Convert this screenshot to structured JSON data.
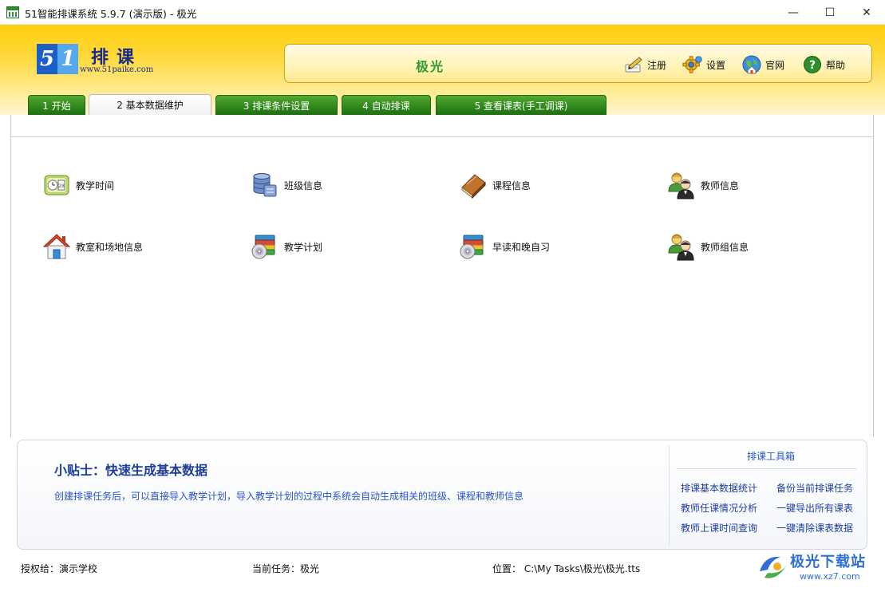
{
  "window": {
    "title": "51智能排课系统 5.9.7 (演示版) - 极光",
    "minimize": "—",
    "maximize": "☐",
    "close": "✕"
  },
  "logo": {
    "digit1": "5",
    "digit2": "1",
    "title": "排课",
    "url": "www.51paike.com"
  },
  "infobar": {
    "task_name": "极光",
    "buttons": [
      {
        "label": "注册",
        "icon": "register-icon"
      },
      {
        "label": "设置",
        "icon": "gear-icon"
      },
      {
        "label": "官网",
        "icon": "globe-icon"
      },
      {
        "label": "帮助",
        "icon": "help-icon"
      }
    ]
  },
  "tabs": [
    {
      "label": "1 开始",
      "active": false
    },
    {
      "label": "2 基本数据维护",
      "active": true
    },
    {
      "label": "3 排课条件设置",
      "active": false
    },
    {
      "label": "4 自动排课",
      "active": false
    },
    {
      "label": "5 查看课表(手工调课)",
      "active": false
    }
  ],
  "items": [
    {
      "label": "教学时间",
      "icon": "calendar-clock-icon"
    },
    {
      "label": "班级信息",
      "icon": "database-icon"
    },
    {
      "label": "课程信息",
      "icon": "book-icon"
    },
    {
      "label": "教师信息",
      "icon": "users-icon"
    },
    {
      "label": "教室和场地信息",
      "icon": "house-icon"
    },
    {
      "label": "教学计划",
      "icon": "archive-disc-icon"
    },
    {
      "label": "早读和晚自习",
      "icon": "archive-disc-icon"
    },
    {
      "label": "教师组信息",
      "icon": "users-icon"
    }
  ],
  "tips": {
    "title": "小贴士：快速生成基本数据",
    "text": "创建排课任务后，可以直接导入教学计划，导入教学计划的过程中系统会自动生成相关的班级、课程和教师信息",
    "toolbox_title": "排课工具箱",
    "links": [
      "排课基本数据统计",
      "备份当前排课任务",
      "教师任课情况分析",
      "一键导出所有课表",
      "教师上课时间查询",
      "一键清除课表数据"
    ]
  },
  "status": {
    "licensed": "授权给：演示学校",
    "current_task": "当前任务：极光",
    "location": "位置： C:\\My Tasks\\极光\\极光.tts"
  },
  "watermark": {
    "text": "极光下载站",
    "url": "www.xz7.com"
  },
  "colors": {
    "header_yellow": "#ffd83a",
    "tab_green": "#2f8a1c",
    "task_green": "#2f9a2f",
    "link_blue": "#2a55c8"
  }
}
